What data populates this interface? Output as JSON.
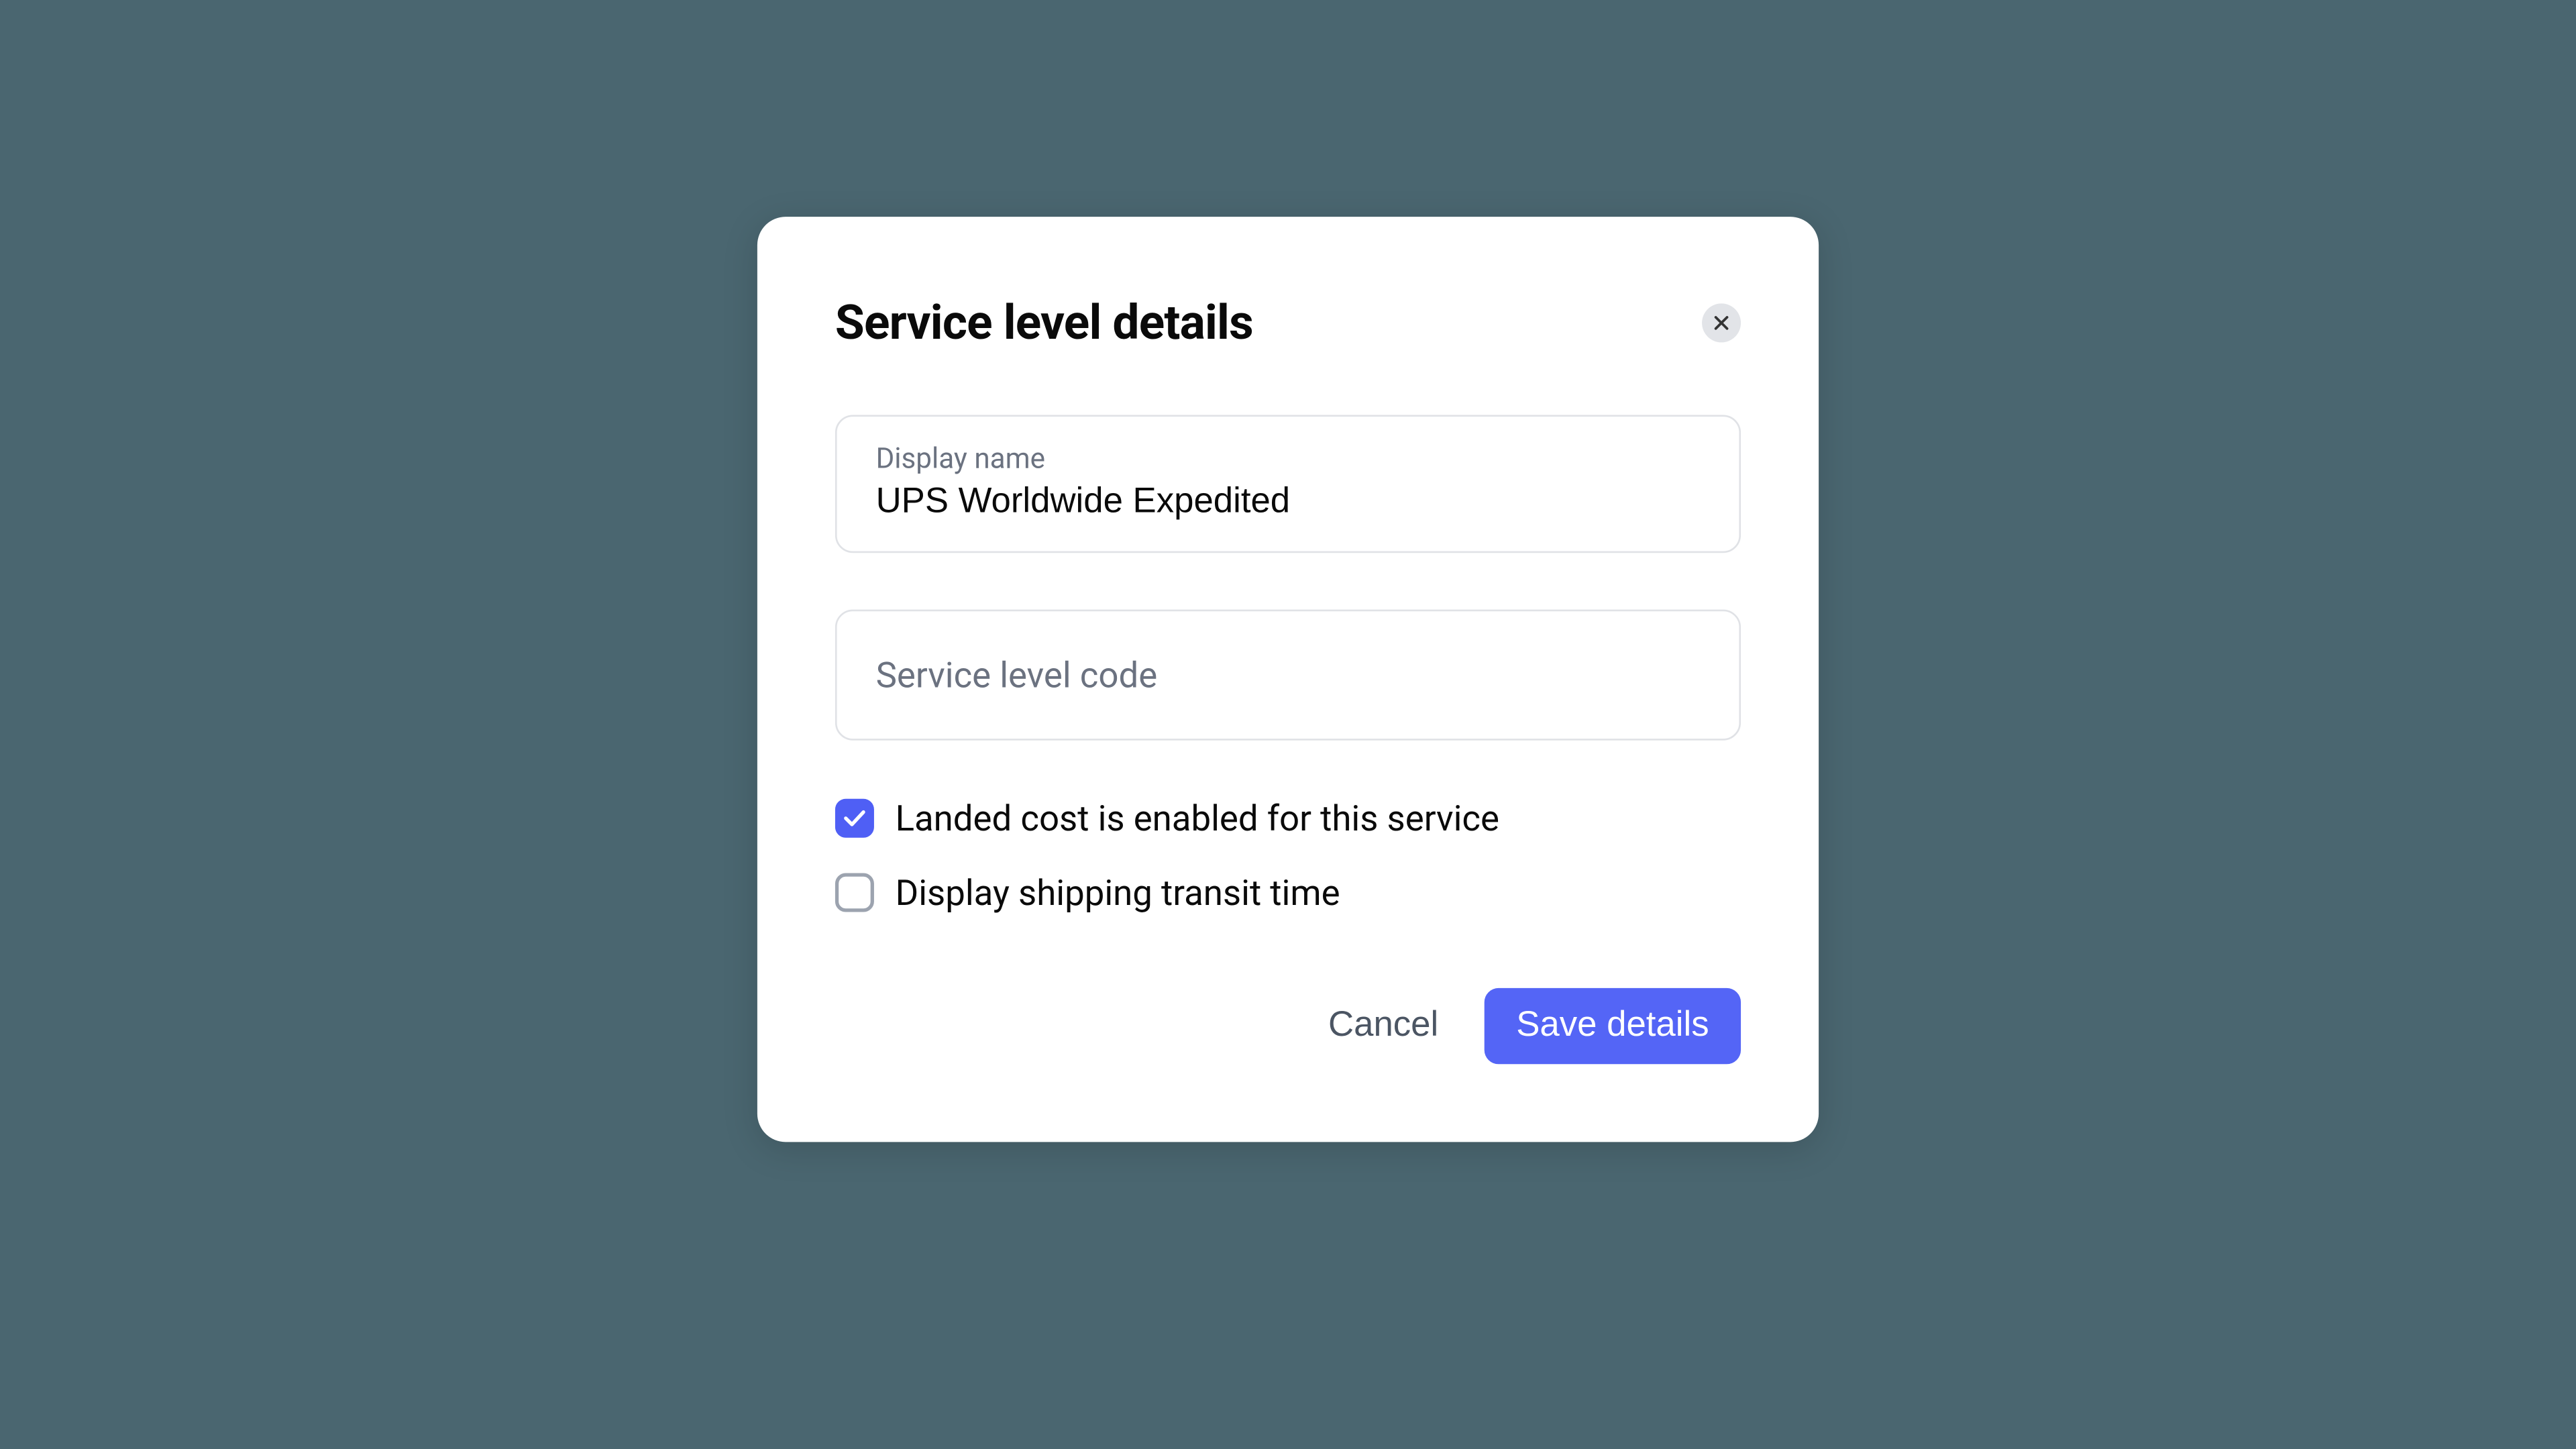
{
  "modal": {
    "title": "Service level details",
    "fields": {
      "display_name": {
        "label": "Display name",
        "value": "UPS Worldwide Expedited"
      },
      "service_level_code": {
        "label": "Service level code",
        "value": ""
      }
    },
    "checkboxes": {
      "landed_cost": {
        "label": "Landed cost is enabled for this service",
        "checked": true
      },
      "transit_time": {
        "label": "Display shipping transit time",
        "checked": false
      }
    },
    "buttons": {
      "cancel": "Cancel",
      "save": "Save details"
    }
  }
}
